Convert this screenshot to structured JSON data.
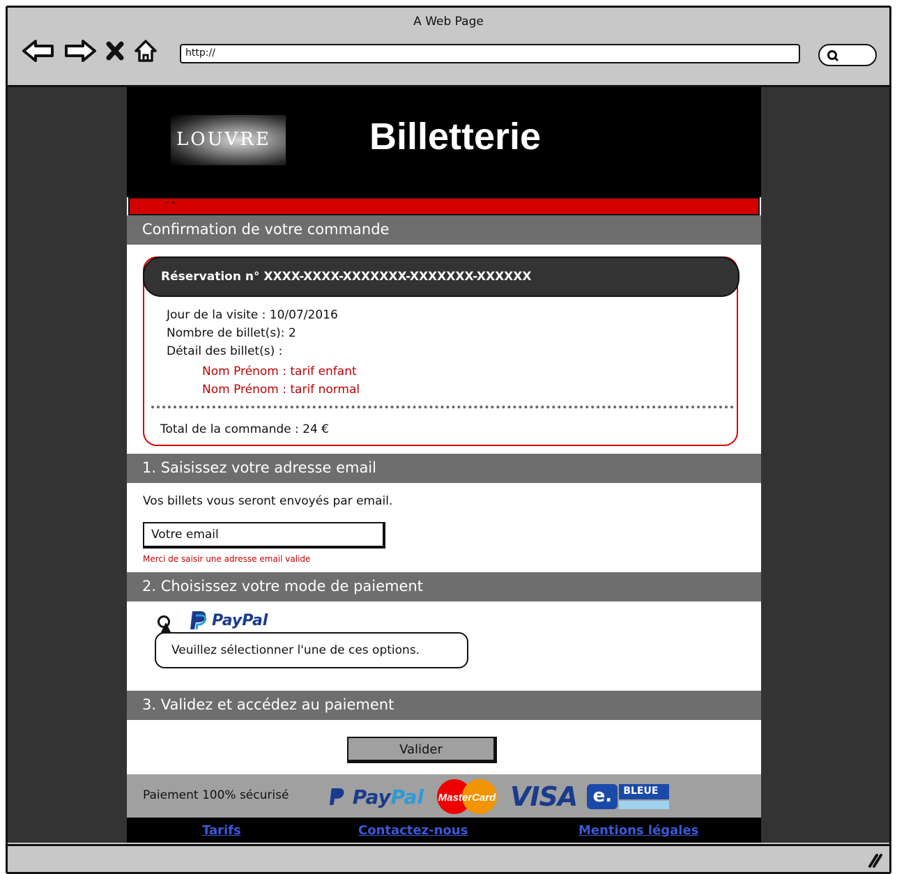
{
  "window": {
    "title": "A Web Page",
    "url": "http://"
  },
  "header": {
    "logo_text": "LOUVRE",
    "title": "Billetterie"
  },
  "confirmation": {
    "heading": "Confirmation de votre commande",
    "reservation_label": "Réservation n° XXXX-XXXX-XXXXXXX-XXXXXXX-XXXXXX",
    "visit_day": "Jour de la visite : 10/07/2016",
    "ticket_count": "Nombre de billet(s): 2",
    "details_label": "Détail des billet(s) :",
    "tickets": [
      "Nom Prénom : tarif enfant",
      "Nom Prénom : tarif normal"
    ],
    "total": "Total de la commande : 24 €"
  },
  "email_section": {
    "heading": "1. Saisissez votre adresse email",
    "info": "Vos billets vous seront envoyés par email.",
    "placeholder": "Votre email",
    "error": "Merci de saisir une adresse email valide"
  },
  "payment_section": {
    "heading": "2. Choisissez votre mode de paiement",
    "paypal_label": "PayPal",
    "tooltip": "Veuillez sélectionner l'une de ces options."
  },
  "validate_section": {
    "heading": "3. Validez et accédez au paiement",
    "button": "Valider"
  },
  "secure": {
    "text": "Paiement 100% sécurisé",
    "paypal_a": "Pay",
    "paypal_b": "Pal",
    "mastercard": "MasterCard",
    "visa": "VISA",
    "ebleue_e": "e.",
    "ebleue": "BLEUE"
  },
  "footer": {
    "links": [
      "Tarifs",
      "Contactez-nous",
      "Mentions légales"
    ]
  },
  "colors": {
    "accent_red": "#d40000",
    "section_gray": "#6e6e6e",
    "link_blue": "#3a5ad6"
  }
}
